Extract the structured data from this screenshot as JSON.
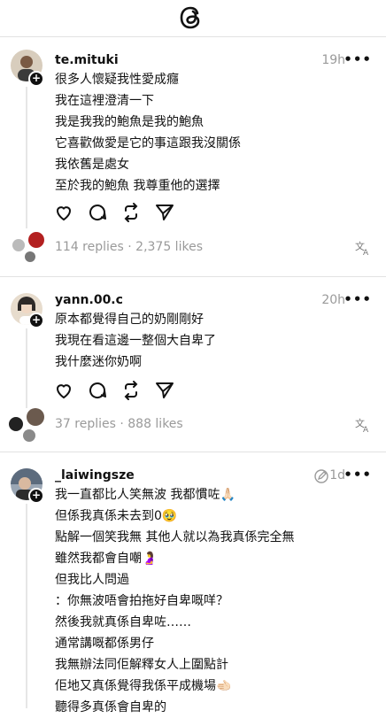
{
  "app": {
    "logo_icon": "threads-logo-icon"
  },
  "posts": [
    {
      "username": "te.mituki",
      "time": "19h",
      "more": "•••",
      "lines": [
        "很多人懷疑我性愛成癮",
        "我在這裡澄清一下",
        "我是我我的鮑魚是我的鮑魚",
        "它喜歡做愛是它的事這跟我沒關係",
        "我依舊是處女",
        "至於我的鮑魚 我尊重他的選擇"
      ],
      "stats": "114 replies · 2,375 likes"
    },
    {
      "username": "yann.00.c",
      "time": "20h",
      "more": "•••",
      "lines": [
        "原本都覺得自己的奶剛剛好",
        "我現在看這邊一整個大自卑了",
        "我什麼迷你奶啊"
      ],
      "stats": "37 replies · 888 likes"
    },
    {
      "username": "_laiwingsze",
      "time": "1d",
      "more": "•••",
      "lines": [
        "我一直都比人笑無波 我都慣咗🙏🏻",
        "但係我真係未去到0🥹",
        "點解一個笑我無 其他人就以為我真係完全無",
        "雖然我都會自嘲🤰",
        "但我比人問過",
        "：你無波唔會拍拖好自卑嘅咩？",
        "然後我就真係自卑咗……",
        "通常講嘅都係男仔",
        "我無辦法同佢解釋女人上圍點計",
        "佢地又真係覺得我係平成機場🫲🏻",
        "聽得多真係會自卑的"
      ]
    }
  ],
  "icons": [
    "heart-icon",
    "comment-icon",
    "repost-icon",
    "share-icon",
    "translate-icon",
    "edited-icon",
    "more-icon"
  ]
}
